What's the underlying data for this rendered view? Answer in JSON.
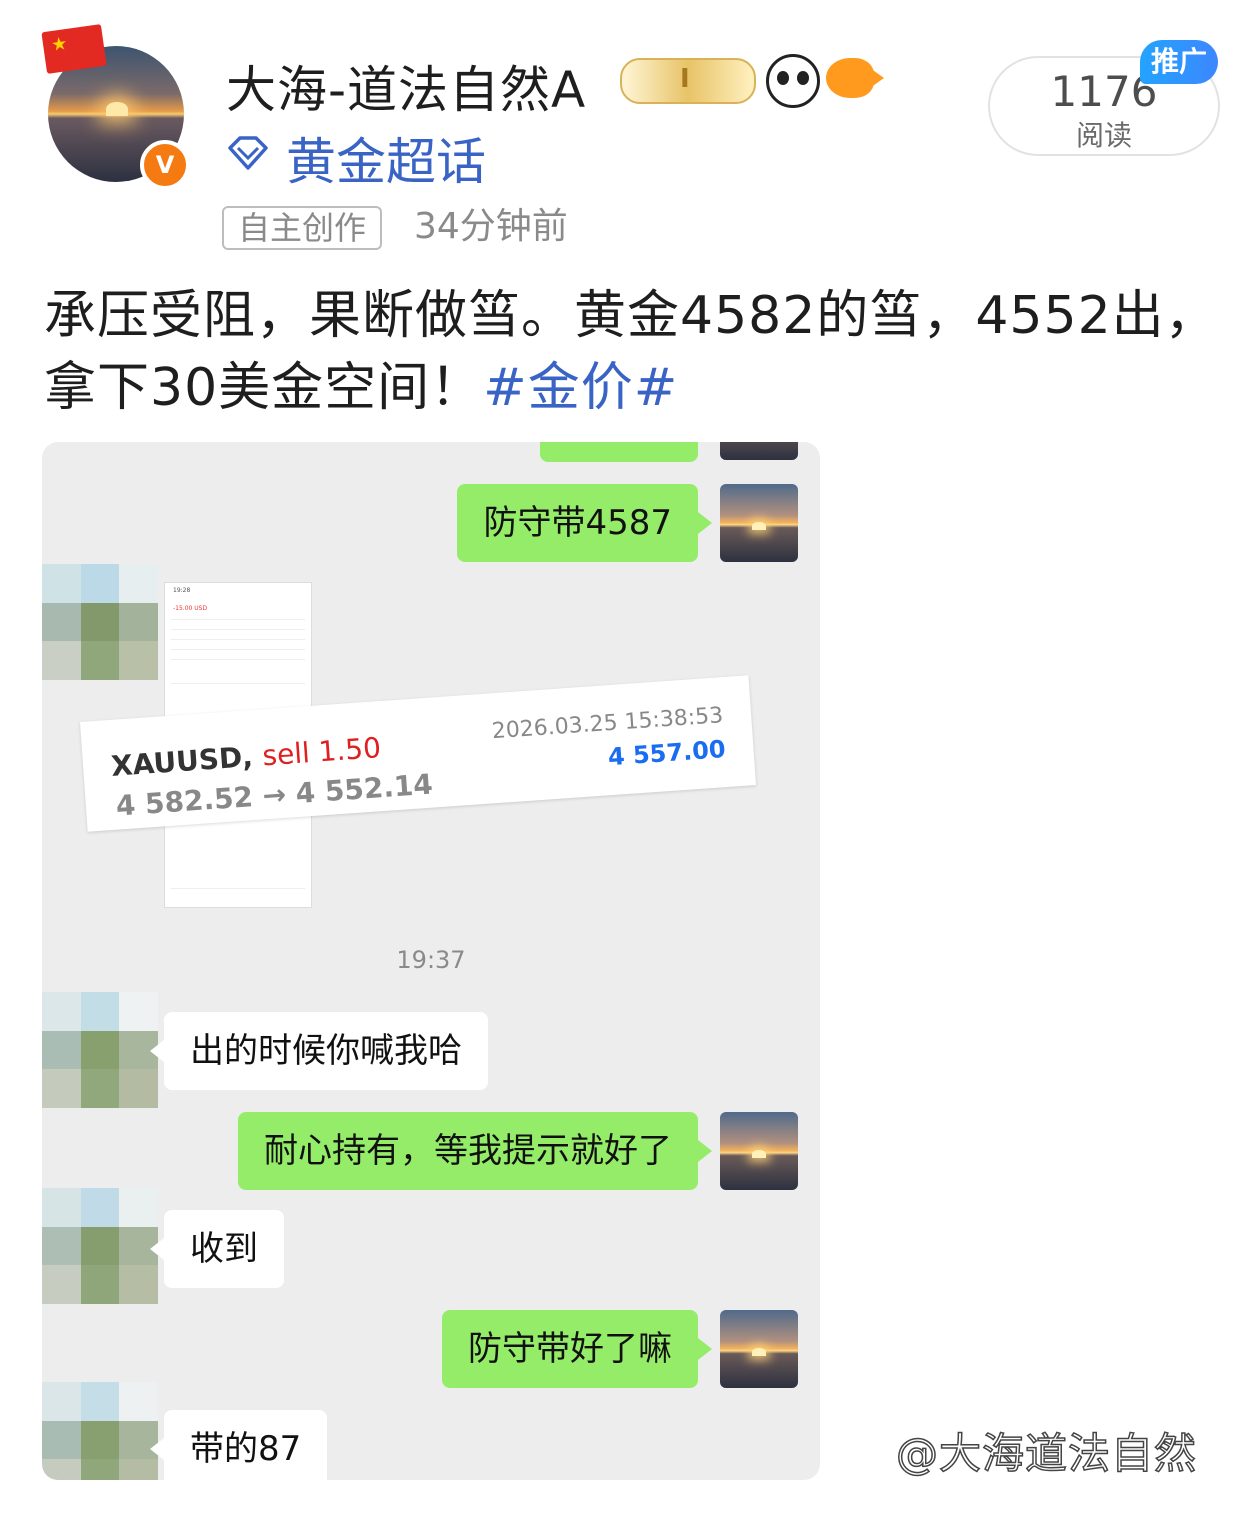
{
  "post": {
    "username": "大海-道法自然A",
    "topic": "黄金超话",
    "tag": "自主创作",
    "time_ago": "34分钟前",
    "reads_count": "1176",
    "reads_label": "阅读",
    "promo_label": "推广",
    "text": "承压受阻，果断做筜。黄金4582的筜，4552出，拿下30美金空间！",
    "hashtag": "#金价#"
  },
  "chat": {
    "messages": [
      {
        "side": "me",
        "text": "防守带4587"
      },
      {
        "side": "other",
        "text": "出的时候你喊我哈"
      },
      {
        "side": "me",
        "text": "耐心持有，等我提示就好了"
      },
      {
        "side": "other",
        "text": "收到"
      },
      {
        "side": "me",
        "text": "防守带好了嘛"
      },
      {
        "side": "other",
        "text": "带的87"
      }
    ],
    "timestamp": "19:37",
    "trade": {
      "symbol": "XAUUSD,",
      "action": "sell 1.50",
      "prices": "4 582.52 → 4 552.14",
      "datetime": "2026.03.25 15:38:53",
      "close": "4 557.00"
    }
  },
  "watermark": "@大海道法自然",
  "colors": {
    "topic_blue": "#3a63c6",
    "bubble_green": "#95ec69",
    "sell_red": "#e02020",
    "close_blue": "#1a6cf0"
  }
}
